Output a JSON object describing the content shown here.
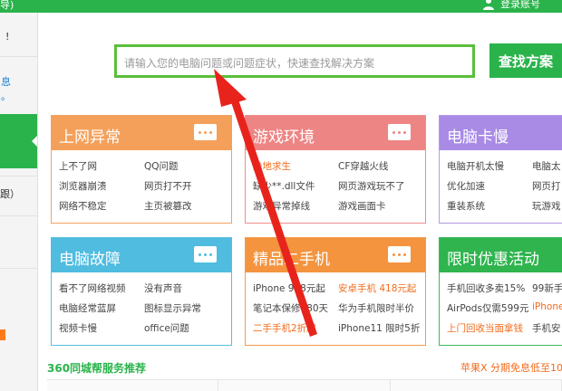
{
  "topbar": {
    "left_text": "导)",
    "user_text": "登录账号"
  },
  "sidebar": {
    "mark": "!",
    "blue_labels": [
      "息",
      "。"
    ],
    "dash_label": "跟）"
  },
  "search": {
    "placeholder": "请输入您的电脑问题或问题症状，快速查找解决方案",
    "button_label": "查找方案"
  },
  "cards": [
    {
      "title": "上网异常",
      "items": [
        {
          "text": "上不了网",
          "hl": false
        },
        {
          "text": "QQ问题",
          "hl": false
        },
        {
          "text": "浏览器崩溃",
          "hl": false
        },
        {
          "text": "网页打不开",
          "hl": false
        },
        {
          "text": "网络不稳定",
          "hl": false
        },
        {
          "text": "主页被篡改",
          "hl": false
        }
      ]
    },
    {
      "title": "游戏环境",
      "items": [
        {
          "text": "绝地求生",
          "hl": true
        },
        {
          "text": "CF穿越火线",
          "hl": false
        },
        {
          "text": "缺少**.dll文件",
          "hl": false
        },
        {
          "text": "网页游戏玩不了",
          "hl": false
        },
        {
          "text": "游戏异常掉线",
          "hl": false
        },
        {
          "text": "游戏画面卡",
          "hl": false
        }
      ]
    },
    {
      "title": "电脑卡慢",
      "items": [
        {
          "text": "电脑开机太慢",
          "hl": false
        },
        {
          "text": "电脑太",
          "hl": false
        },
        {
          "text": "优化加速",
          "hl": false
        },
        {
          "text": "网页打",
          "hl": false
        },
        {
          "text": "重装系统",
          "hl": false
        },
        {
          "text": "玩游戏",
          "hl": false
        }
      ]
    },
    {
      "title": "电脑故障",
      "items": [
        {
          "text": "看不了网络视频",
          "hl": false
        },
        {
          "text": "没有声音",
          "hl": false
        },
        {
          "text": "电脑经常蓝屏",
          "hl": false
        },
        {
          "text": "图标显示异常",
          "hl": false
        },
        {
          "text": "视频卡慢",
          "hl": false
        },
        {
          "text": "office问题",
          "hl": false
        }
      ]
    },
    {
      "title": "精品二手机",
      "items": [
        {
          "text": "iPhone 968元起",
          "hl": false
        },
        {
          "text": "安卓手机 418元起",
          "hl": true
        },
        {
          "text": "笔记本保修180天",
          "hl": false
        },
        {
          "text": "华为手机限时半价",
          "hl": false
        },
        {
          "text": "二手手机2折起",
          "hl": true
        },
        {
          "text": "iPhone11 限时5折",
          "hl": false
        }
      ]
    },
    {
      "title": "限时优惠活动",
      "items": [
        {
          "text": "手机回收多卖15%",
          "hl": false
        },
        {
          "text": "99新手",
          "hl": false
        },
        {
          "text": "AirPods仅需599元",
          "hl": false
        },
        {
          "text": "iPhone",
          "hl": true
        },
        {
          "text": "上门回收当面拿钱",
          "hl": true
        },
        {
          "text": "手机安",
          "hl": false
        }
      ]
    }
  ],
  "bottom": {
    "title": "360同城帮服务推荐",
    "promo": "苹果X 分期免息低至10"
  },
  "colors": {
    "brand_green": "#2ab34b",
    "highlight_orange": "#f26c1d",
    "arrow_red": "#e8231c"
  },
  "icons": [
    "user-icon",
    "more-icon",
    "arrow-annotation"
  ]
}
